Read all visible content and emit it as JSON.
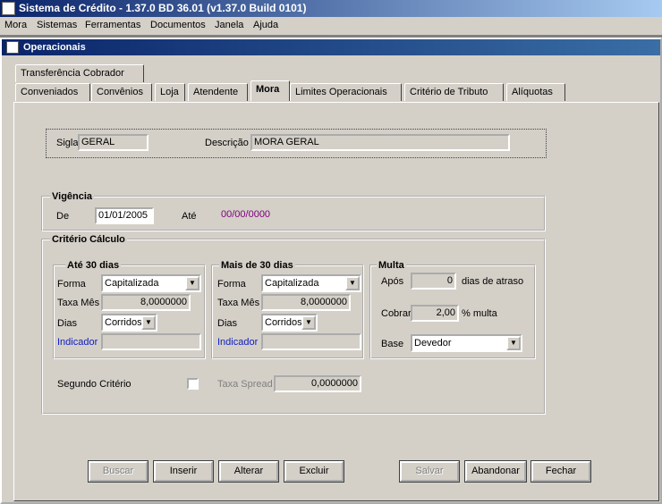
{
  "window": {
    "title": "Sistema de Crédito - 1.37.0 BD 36.01 (v1.37.0 Build 0101)"
  },
  "menu": [
    "Mora",
    "Sistemas",
    "Ferramentas",
    "Documentos",
    "Janela",
    "Ajuda"
  ],
  "child": {
    "title": "Operacionais"
  },
  "tabs_row1": [
    "Transferência Cobrador"
  ],
  "tabs_row2": [
    "Conveniados",
    "Convênios",
    "Loja",
    "Atendente",
    "Mora",
    "Limites Operacionais",
    "Critério de Tributo",
    "Alíquotas"
  ],
  "active_tab": "Mora",
  "header": {
    "sigla_label": "Sigla",
    "sigla_value": "GERAL",
    "descricao_label": "Descrição",
    "descricao_value": "MORA GERAL"
  },
  "vigencia": {
    "title": "Vigência",
    "de_label": "De",
    "de_value": "01/01/2005",
    "ate_label": "Até",
    "ate_value": "00/00/0000"
  },
  "criterio": {
    "title": "Critério Cálculo",
    "ate30": {
      "title": "Até 30 dias",
      "forma_label": "Forma",
      "forma_value": "Capitalizada",
      "taxa_label": "Taxa Mês",
      "taxa_value": "8,0000000",
      "dias_label": "Dias",
      "dias_value": "Corridos",
      "indicador_label": "Indicador",
      "indicador_value": ""
    },
    "mais30": {
      "title": "Mais de 30 dias",
      "forma_label": "Forma",
      "forma_value": "Capitalizada",
      "taxa_label": "Taxa Mês",
      "taxa_value": "8,0000000",
      "dias_label": "Dias",
      "dias_value": "Corridos",
      "indicador_label": "Indicador",
      "indicador_value": ""
    },
    "multa": {
      "title": "Multa",
      "apos_label": "Após",
      "apos_value": "0",
      "apos_suffix": "dias de atraso",
      "cobrar_label": "Cobrar",
      "cobrar_value": "2,00",
      "cobrar_suffix": "% multa",
      "base_label": "Base",
      "base_value": "Devedor"
    },
    "segundo_label": "Segundo Critério",
    "spread_label": "Taxa Spread",
    "spread_value": "0,0000000"
  },
  "buttons": {
    "buscar": "Buscar",
    "inserir": "Inserir",
    "alterar": "Alterar",
    "excluir": "Excluir",
    "salvar": "Salvar",
    "abandonar": "Abandonar",
    "fechar": "Fechar"
  }
}
